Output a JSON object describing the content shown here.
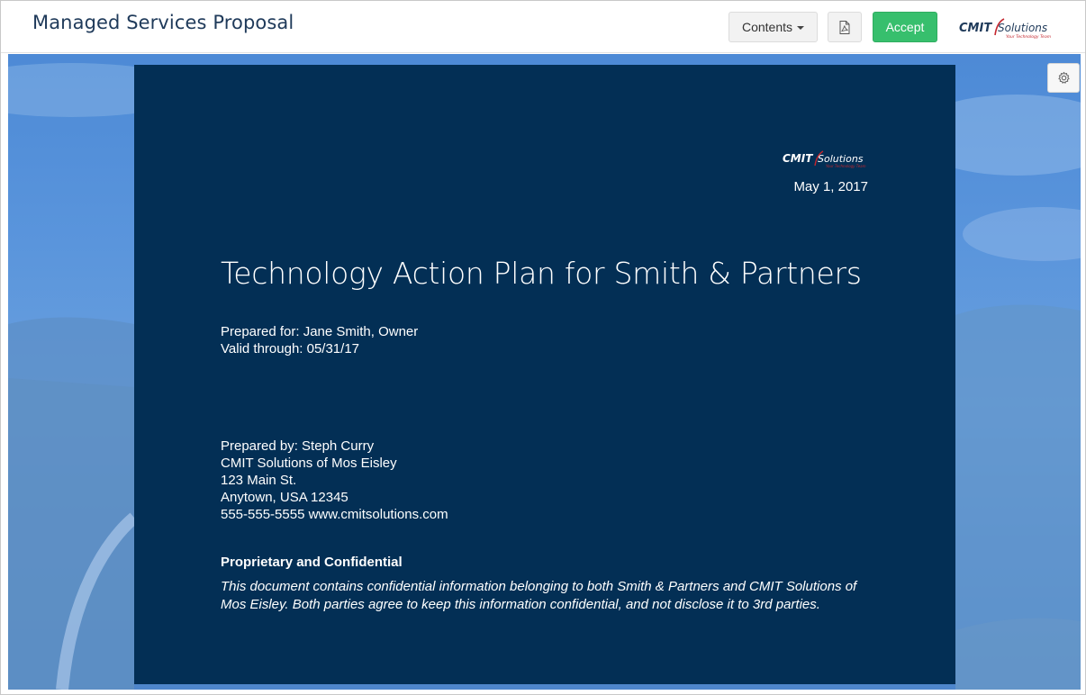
{
  "header": {
    "title": "Managed Services Proposal",
    "contents_label": "Contents",
    "pdf_icon": "pdf-file-icon",
    "accept_label": "Accept",
    "brand": {
      "name_main": "CMIT",
      "name_sub": "Solutions",
      "tagline": "Your Technology Team"
    }
  },
  "toolbar": {
    "settings_icon": "gear-icon"
  },
  "cover": {
    "logo": {
      "name_main": "CMIT",
      "name_sub": "Solutions",
      "tagline": "Your Technology Team"
    },
    "date": "May 1, 2017",
    "title": "Technology Action Plan for Smith & Partners",
    "prepared_for": [
      "Prepared for: Jane Smith, Owner",
      "Valid through: 05/31/17"
    ],
    "prepared_by": [
      "Prepared by: Steph Curry",
      "CMIT Solutions of Mos Eisley",
      "123 Main St.",
      "Anytown, USA 12345",
      "555-555-5555 www.cmitsolutions.com"
    ],
    "confidential_heading": "Proprietary and Confidential",
    "confidential_lines": [
      "This document contains confidential information belonging to both Smith & Partners and CMIT Solutions of",
      "Mos Eisley. Both parties agree to keep this information confidential, and not disclose it to 3rd parties."
    ]
  },
  "colors": {
    "accent_green": "#37bf6d",
    "cover_navy": "#032f55",
    "title_navy": "#1f3a5a",
    "brand_red": "#c4262e"
  }
}
